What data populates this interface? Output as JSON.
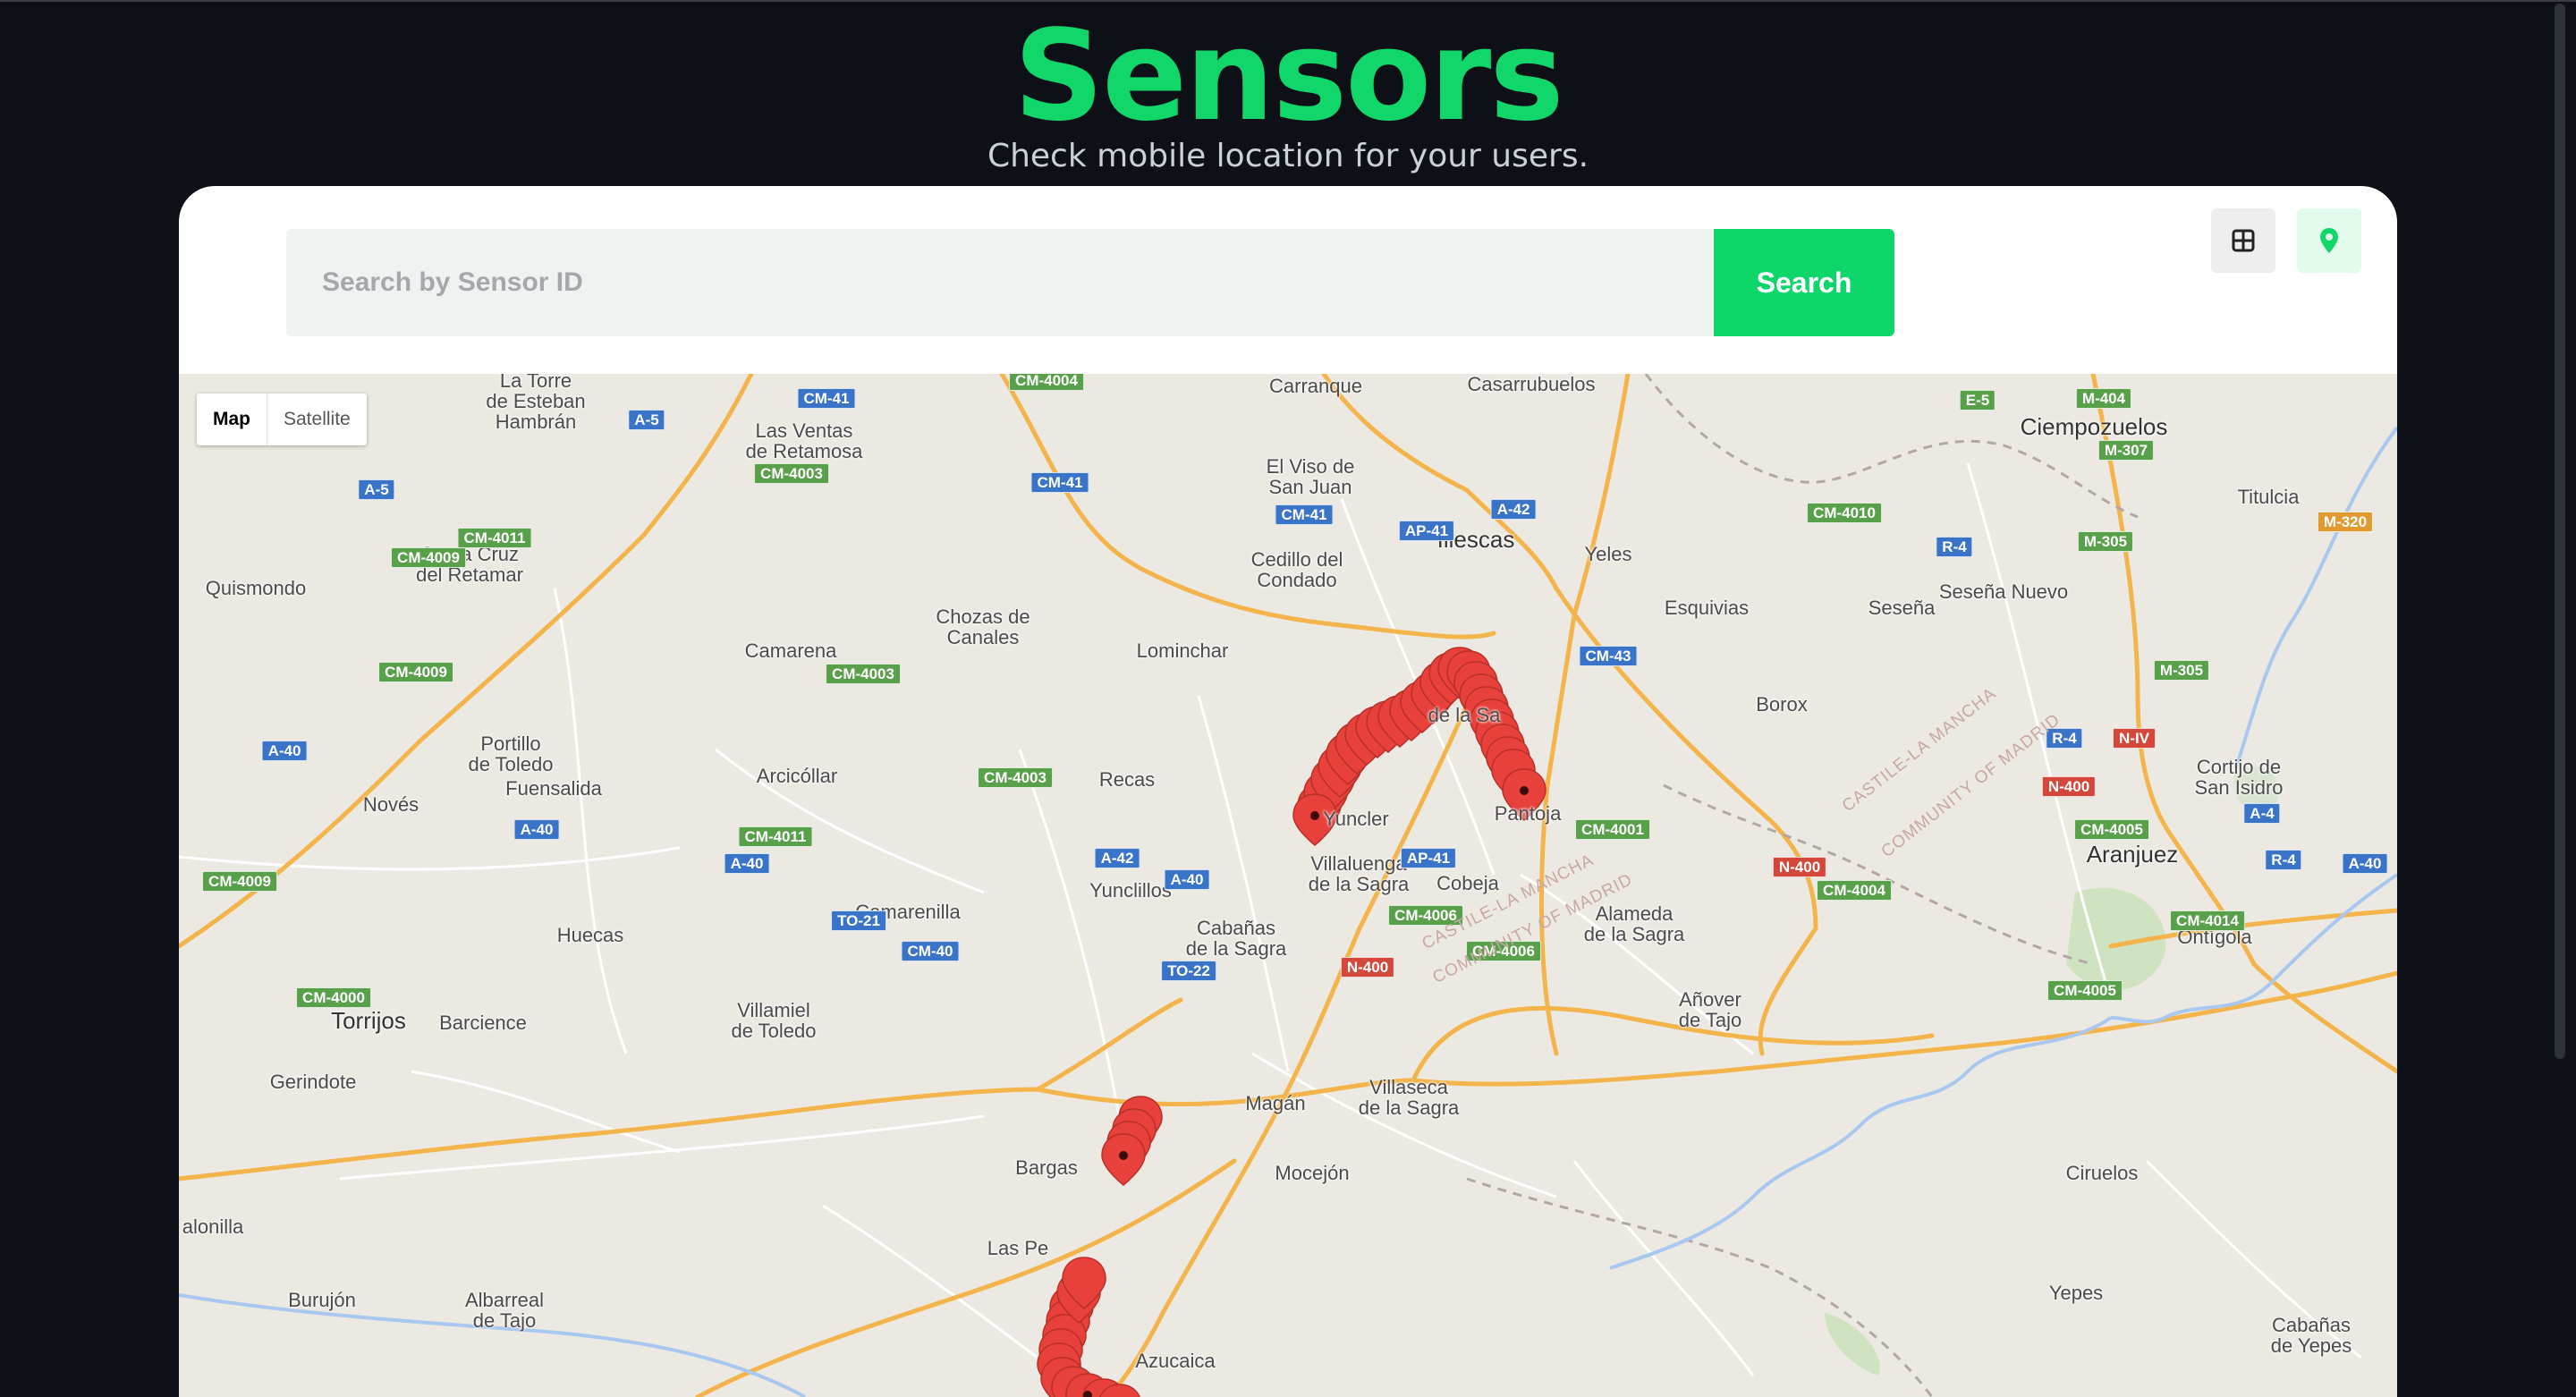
{
  "header": {
    "title": "Sensors",
    "subtitle": "Check mobile location for your users."
  },
  "search": {
    "placeholder": "Search by Sensor ID",
    "value": "",
    "button_label": "Search"
  },
  "view_toggle": {
    "grid_icon": "grid-icon",
    "map_icon": "map-pin-icon",
    "active": "map"
  },
  "colors": {
    "accent": "#11d66a",
    "background": "#0d1117",
    "marker": "#e8413b"
  },
  "map": {
    "type_control": {
      "map_label": "Map",
      "satellite_label": "Satellite",
      "selected": "Map"
    },
    "places": [
      "La Torre\nde Esteban\nHambrán",
      "Las Ventas\nde Retamosa",
      "Carranque",
      "Casarrubuelos",
      "Ciempozuelos",
      "Titulcia",
      "El Viso de\nSan Juan",
      "Illescas",
      "Yeles",
      "Esquivias",
      "Seseña Nuevo",
      "Seseña",
      "Santa Cruz\ndel Retamar",
      "Quismondo",
      "Cedillo del\nCondado",
      "Chozas de\nCanales",
      "Camarena",
      "Lominchar",
      "Borox",
      "Portillo\nde Toledo",
      "Fuensalida",
      "Novés",
      "Arcicóllar",
      "Recas",
      "Yuncler",
      "Pantoja",
      "Cortijo de\nSan Isidro",
      "Aranjuez",
      "Villaluenga\nde la Sagra",
      "Cobeja",
      "Yunclillos",
      "Camarenilla",
      "Cabañas\nde la Sagra",
      "Alameda\nde la Sagra",
      "Ontígola",
      "Huecas",
      "Villamiel\nde Toledo",
      "Torrijos",
      "Barcience",
      "Añover\nde Tajo",
      "Gerindote",
      "Magán",
      "Villaseca\nde la Sagra",
      "Mocejón",
      "Bargas",
      "Ciruelos",
      "alonilla",
      "Las Pe",
      "Burujón",
      "Albarreal\nde Tajo",
      "Yepes",
      "Azucaica",
      "Cabañas\nde Yepes",
      "de la Sa"
    ],
    "road_shields": [
      {
        "label": "CM-41",
        "color": "blue"
      },
      {
        "label": "CM-4004",
        "color": "green"
      },
      {
        "label": "A-5",
        "color": "blue"
      },
      {
        "label": "E-5",
        "color": "green"
      },
      {
        "label": "M-404",
        "color": "green"
      },
      {
        "label": "M-307",
        "color": "green"
      },
      {
        "label": "CM-4003",
        "color": "green"
      },
      {
        "label": "CM-41",
        "color": "blue"
      },
      {
        "label": "A-5",
        "color": "blue"
      },
      {
        "label": "A-42",
        "color": "blue"
      },
      {
        "label": "CM-41",
        "color": "blue"
      },
      {
        "label": "AP-41",
        "color": "blue"
      },
      {
        "label": "CM-4010",
        "color": "green"
      },
      {
        "label": "M-320",
        "color": "orange"
      },
      {
        "label": "CM-4011",
        "color": "green"
      },
      {
        "label": "CM-4009",
        "color": "green"
      },
      {
        "label": "R-4",
        "color": "blue"
      },
      {
        "label": "M-305",
        "color": "green"
      },
      {
        "label": "CM-43",
        "color": "blue"
      },
      {
        "label": "CM-4009",
        "color": "green"
      },
      {
        "label": "CM-4003",
        "color": "green"
      },
      {
        "label": "M-305",
        "color": "green"
      },
      {
        "label": "R-4",
        "color": "blue"
      },
      {
        "label": "N-IV",
        "color": "red"
      },
      {
        "label": "A-40",
        "color": "blue"
      },
      {
        "label": "CM-4003",
        "color": "green"
      },
      {
        "label": "N-400",
        "color": "red"
      },
      {
        "label": "A-4",
        "color": "blue"
      },
      {
        "label": "A-40",
        "color": "blue"
      },
      {
        "label": "CM-4011",
        "color": "green"
      },
      {
        "label": "CM-4001",
        "color": "green"
      },
      {
        "label": "CM-4005",
        "color": "green"
      },
      {
        "label": "A-40",
        "color": "blue"
      },
      {
        "label": "A-42",
        "color": "blue"
      },
      {
        "label": "AP-41",
        "color": "blue"
      },
      {
        "label": "R-4",
        "color": "blue"
      },
      {
        "label": "A-40",
        "color": "blue"
      },
      {
        "label": "CM-4009",
        "color": "green"
      },
      {
        "label": "A-40",
        "color": "blue"
      },
      {
        "label": "N-400",
        "color": "red"
      },
      {
        "label": "CM-4004",
        "color": "green"
      },
      {
        "label": "TO-21",
        "color": "blue"
      },
      {
        "label": "CM-4006",
        "color": "green"
      },
      {
        "label": "CM-4014",
        "color": "green"
      },
      {
        "label": "CM-40",
        "color": "blue"
      },
      {
        "label": "CM-4006",
        "color": "green"
      },
      {
        "label": "TO-22",
        "color": "blue"
      },
      {
        "label": "N-400",
        "color": "red"
      },
      {
        "label": "CM-4000",
        "color": "green"
      },
      {
        "label": "CM-4005",
        "color": "green"
      }
    ],
    "border_labels": [
      "CASTILE-LA MANCHA",
      "COMMUNITY OF MADRID",
      "CASTILE-LA MANCHA",
      "COMMUNITY OF MADRID"
    ],
    "marker_count_visible": 52
  }
}
